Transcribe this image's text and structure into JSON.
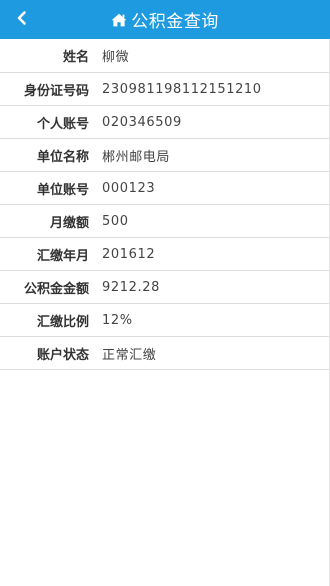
{
  "header": {
    "title": "公积金查询",
    "accent_color": "#1e9ae0",
    "back_icon": "chevron-left-icon",
    "title_icon": "home-icon"
  },
  "fields": [
    {
      "label": "姓名",
      "value": "柳微"
    },
    {
      "label": "身份证号码",
      "value": "230981198112151210"
    },
    {
      "label": "个人账号",
      "value": "020346509"
    },
    {
      "label": "单位名称",
      "value": "郴州邮电局"
    },
    {
      "label": "单位账号",
      "value": "000123"
    },
    {
      "label": "月缴额",
      "value": "500"
    },
    {
      "label": "汇缴年月",
      "value": "201612"
    },
    {
      "label": "公积金金额",
      "value": "9212.28"
    },
    {
      "label": "汇缴比例",
      "value": "12%"
    },
    {
      "label": "账户状态",
      "value": "正常汇缴"
    }
  ]
}
